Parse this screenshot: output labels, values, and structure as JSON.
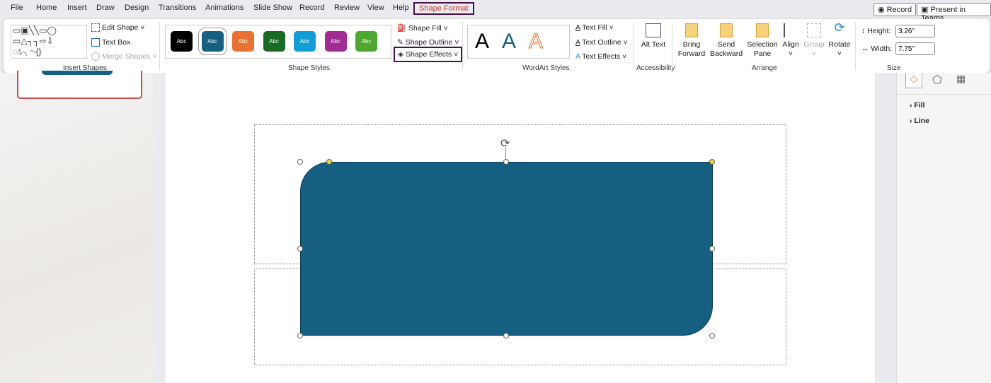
{
  "tabs": [
    "File",
    "Home",
    "Insert",
    "Draw",
    "Design",
    "Transitions",
    "Animations",
    "Slide Show",
    "Record",
    "Review",
    "View",
    "Help",
    "Shape Format"
  ],
  "active_tab": "Shape Format",
  "top_buttons": {
    "record": "Record",
    "present": "Present in Teams"
  },
  "insert_shapes": {
    "edit_shape": "Edit Shape",
    "text_box": "Text Box",
    "merge_shapes": "Merge Shapes",
    "label": "Insert Shapes"
  },
  "shape_styles": {
    "swatches": [
      {
        "text": "Abc",
        "color": "#000000"
      },
      {
        "text": "Abc",
        "color": "#156082"
      },
      {
        "text": "Abc",
        "color": "#e97132"
      },
      {
        "text": "Abc",
        "color": "#196b24"
      },
      {
        "text": "Abc",
        "color": "#0f9ed5"
      },
      {
        "text": "Abc",
        "color": "#a02b93"
      },
      {
        "text": "Abc",
        "color": "#4ea72e"
      }
    ],
    "fill": "Shape Fill",
    "outline": "Shape Outline",
    "effects": "Shape Effects",
    "label": "Shape Styles"
  },
  "wordart": {
    "letters": [
      "A",
      "A",
      "A"
    ],
    "text_fill": "Text Fill",
    "text_outline": "Text Outline",
    "text_effects": "Text Effects",
    "label": "WordArt Styles"
  },
  "accessibility": {
    "alt_text": "Alt Text",
    "label": "Accessibility"
  },
  "arrange": {
    "bring_forward": "Bring Forward",
    "send_backward": "Send Backward",
    "selection_pane": "Selection Pane",
    "align": "Align",
    "group": "Group",
    "rotate": "Rotate",
    "label": "Arrange"
  },
  "size": {
    "height_label": "Height:",
    "height_value": "3.26\"",
    "width_label": "Width:",
    "width_value": "7.75\"",
    "label": "Size"
  },
  "format_pane": {
    "fill": "Fill",
    "line": "Line"
  },
  "colors": {
    "shape": "#156082",
    "accent": "#c0392b",
    "highlight": "#4b1248"
  }
}
